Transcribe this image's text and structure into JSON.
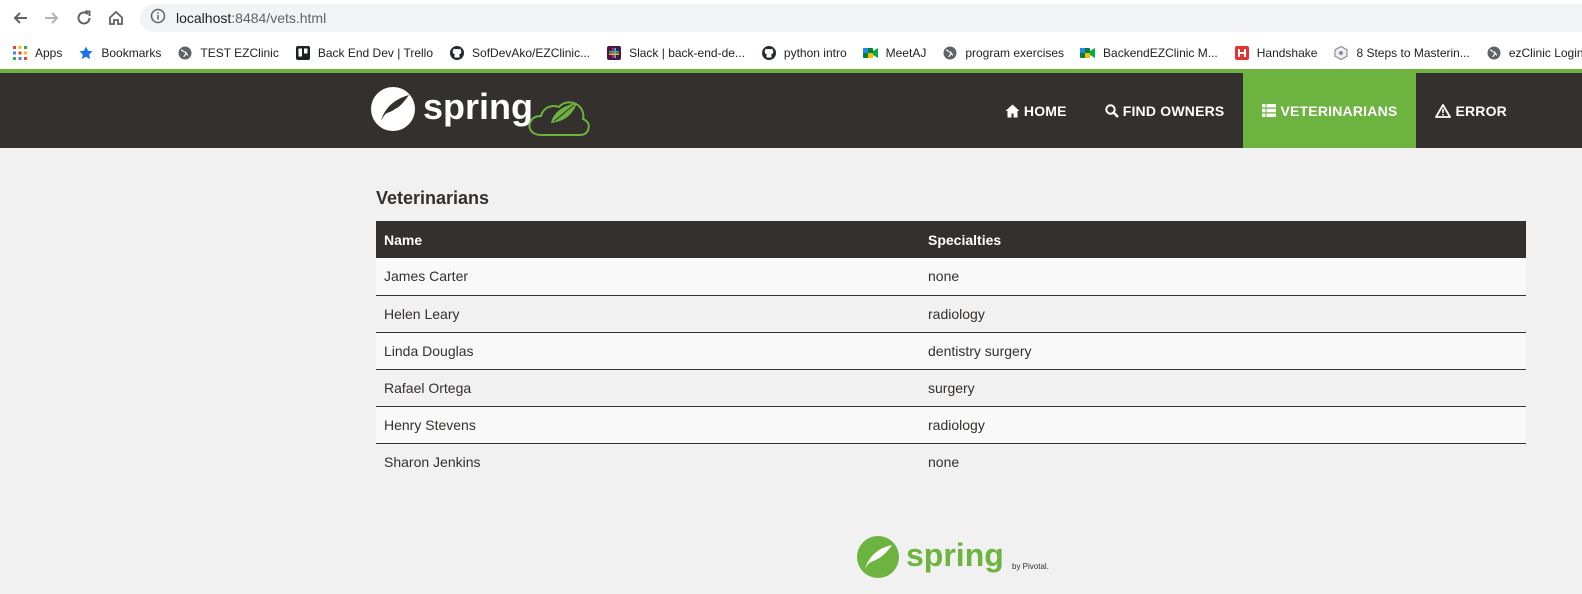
{
  "browser": {
    "url_host": "localhost",
    "url_rest": ":8484/vets.html",
    "bookmarks": [
      {
        "label": "Apps",
        "icon": "apps-grid-icon"
      },
      {
        "label": "Bookmarks",
        "icon": "star-icon"
      },
      {
        "label": "TEST EZClinic",
        "icon": "globe-icon"
      },
      {
        "label": "Back End Dev | Trello",
        "icon": "trello-icon"
      },
      {
        "label": "SofDevAko/EZClinic...",
        "icon": "github-icon"
      },
      {
        "label": "Slack | back-end-de...",
        "icon": "slack-icon"
      },
      {
        "label": "python intro",
        "icon": "github-icon"
      },
      {
        "label": "MeetAJ",
        "icon": "meet-icon"
      },
      {
        "label": "program exercises",
        "icon": "globe-icon"
      },
      {
        "label": "BackendEZClinic M...",
        "icon": "meet-icon"
      },
      {
        "label": "Handshake",
        "icon": "handshake-icon"
      },
      {
        "label": "8 Steps to Masterin...",
        "icon": "hexagon-icon"
      },
      {
        "label": "ezClinic Login",
        "icon": "globe-icon"
      }
    ]
  },
  "nav": {
    "brand": "spring",
    "items": [
      {
        "label": "HOME",
        "icon": "home-icon",
        "active": false
      },
      {
        "label": "FIND OWNERS",
        "icon": "search-icon",
        "active": false
      },
      {
        "label": "VETERINARIANS",
        "icon": "list-icon",
        "active": true
      },
      {
        "label": "ERROR",
        "icon": "warning-icon",
        "active": false
      }
    ]
  },
  "page": {
    "title": "Veterinarians",
    "columns": [
      "Name",
      "Specialties"
    ],
    "rows": [
      {
        "name": "James Carter",
        "specialties": "none"
      },
      {
        "name": "Helen Leary",
        "specialties": "radiology"
      },
      {
        "name": "Linda Douglas",
        "specialties": "dentistry surgery"
      },
      {
        "name": "Rafael Ortega",
        "specialties": "surgery"
      },
      {
        "name": "Henry Stevens",
        "specialties": "radiology"
      },
      {
        "name": "Sharon Jenkins",
        "specialties": "none"
      }
    ]
  },
  "footer": {
    "brand": "spring",
    "by": "by Pivotal."
  },
  "colors": {
    "spring_green": "#6db33f",
    "dark_brown": "#34302d",
    "page_bg": "#f1f1f1"
  }
}
